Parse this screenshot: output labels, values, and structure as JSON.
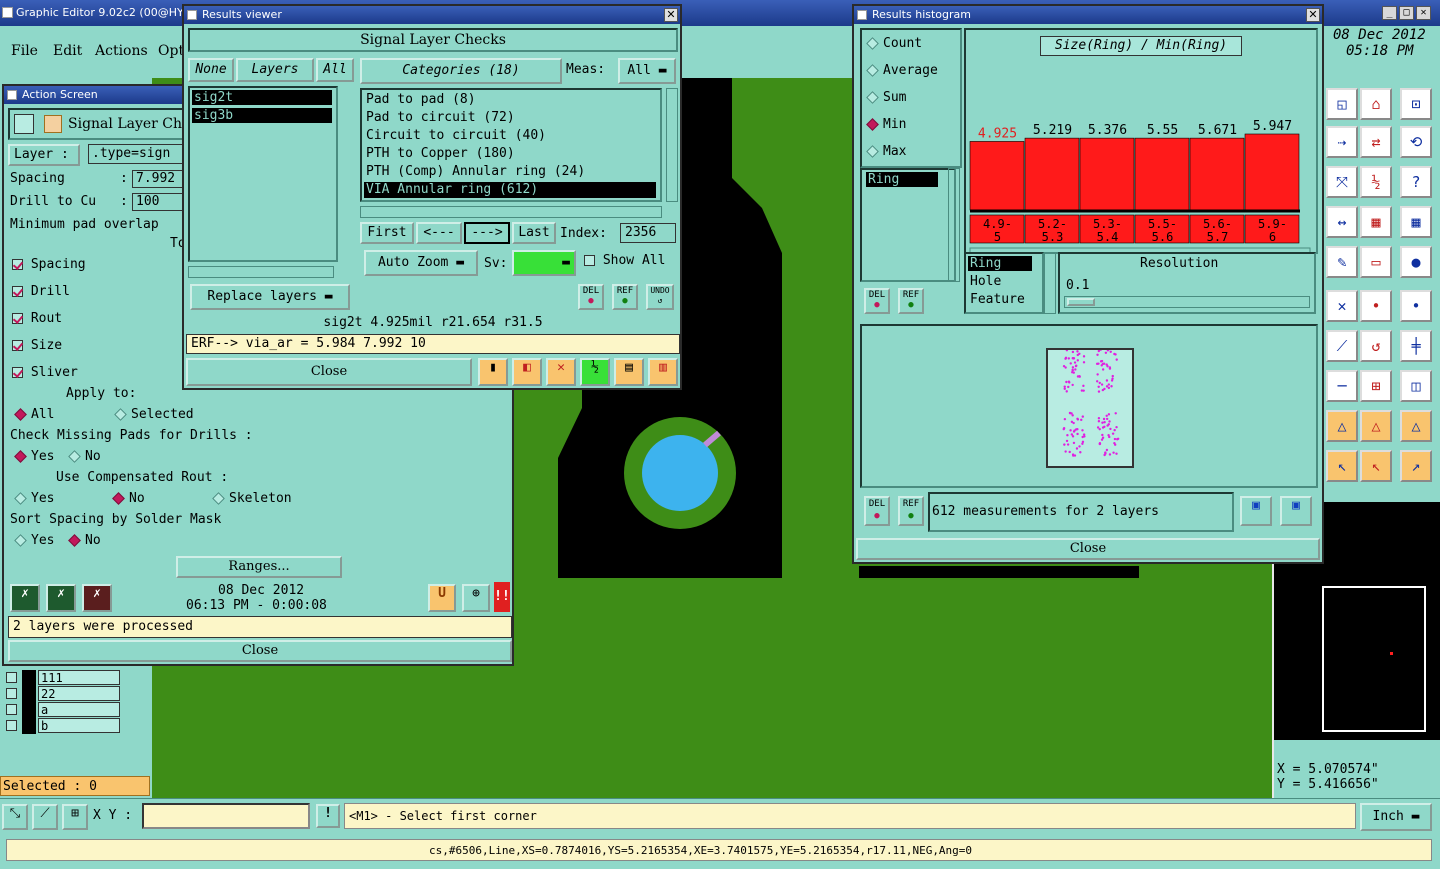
{
  "app": {
    "title": "Graphic Editor 9.02c2 (00@HY",
    "menu": [
      "File",
      "Edit",
      "Actions",
      "Opt"
    ],
    "date": "08 Dec 2012",
    "time": "05:18 PM"
  },
  "action_screen": {
    "title": "Action Screen",
    "header": "Signal Layer Chec",
    "layer_label": "Layer",
    "layer_value": ".type=sign",
    "spacing_label": "Spacing",
    "spacing_value": "7.992",
    "drill_label": "Drill to Cu",
    "drill_value": "100",
    "min_pad_label": "Minimum pad overlap",
    "to_label": "To",
    "checks": [
      "Spacing",
      "Drill",
      "Rout",
      "Size",
      "Sliver"
    ],
    "apply_label": "Apply to:",
    "apply_all": "All",
    "apply_selected": "Selected",
    "missing_pads_label": "Check Missing Pads for Drills :",
    "missing_yes": "Yes",
    "missing_no": "No",
    "comp_rout_label": "Use Compensated Rout :",
    "comp_yes": "Yes",
    "comp_no": "No",
    "comp_skeleton": "Skeleton",
    "sort_label": "Sort Spacing by Solder Mask",
    "sort_yes": "Yes",
    "sort_no": "No",
    "ranges_button": "Ranges...",
    "run_date": "08 Dec 2012",
    "run_time": "06:13 PM - 0:00:08",
    "status": "2 layers were processed",
    "close": "Close"
  },
  "results_viewer": {
    "title": "Results viewer",
    "header": "Signal Layer Checks",
    "none_btn": "None",
    "layers_btn": "Layers",
    "all_btn": "All",
    "layers": [
      "sig2t",
      "sig3b"
    ],
    "categories_btn": "Categories (18)",
    "meas_label": "Meas:",
    "meas_value": "All",
    "categories": [
      "Pad to pad (8)",
      "Pad to circuit (72)",
      "Circuit to circuit (40)",
      "PTH to Copper (180)",
      "PTH (Comp) Annular ring (24)",
      "VIA Annular ring (612)"
    ],
    "first_btn": "First",
    "prev_btn": "<---",
    "next_btn": "--->",
    "last_btn": "Last",
    "index_label": "Index:",
    "index_value": "2356",
    "replace_btn": "Replace layers",
    "autozoom_btn": "Auto Zoom",
    "sv_label": "Sv:",
    "show_all": "Show All",
    "del": "DEL",
    "ref": "REF",
    "undo": "UNDO",
    "info": "sig2t 4.925mil  r21.654  r31.5",
    "erf": "ERF--> via_ar = 5.984 7.992 10",
    "close": "Close"
  },
  "histogram": {
    "title": "Results histogram",
    "options": [
      "Count",
      "Average",
      "Sum",
      "Min",
      "Max"
    ],
    "selected_option": "Min",
    "list_item": "Ring",
    "chart_title": "Size(Ring) / Min(Ring)",
    "feature_list": [
      "Ring",
      "Hole",
      "Feature"
    ],
    "resolution_label": "Resolution",
    "resolution_value": "0.1",
    "measurements": "612 measurements for 2 layers",
    "del": "DEL",
    "ref": "REF",
    "close": "Close"
  },
  "chart_data": {
    "type": "bar",
    "title": "Size(Ring) / Min(Ring)",
    "categories": [
      "4.9-5",
      "5.2-5.3",
      "5.3-5.4",
      "5.5-5.6",
      "5.6-5.7",
      "5.9-6"
    ],
    "value_labels": [
      "4.925",
      "5.219",
      "5.376",
      "5.55",
      "5.671",
      "5.947"
    ],
    "values": [
      4.925,
      5.219,
      5.376,
      5.55,
      5.671,
      5.947
    ],
    "bar_fraction": [
      0.83,
      0.87,
      0.87,
      0.87,
      0.87,
      0.92
    ]
  },
  "layers_panel": {
    "rows": [
      "111",
      "22",
      "a",
      "b"
    ],
    "selected": "Selected : 0"
  },
  "coords": {
    "x": "X = 5.070574\"",
    "y": "Y = 5.416656\""
  },
  "bottom": {
    "xy_label": "X Y :",
    "prompt": "<M1> - Select first corner",
    "units": "Inch",
    "status_line": "cs,#6506,Line,XS=0.7874016,YS=5.2165354,XE=3.7401575,YE=5.2165354,r17.11,NEG,Ang=0"
  },
  "colors": {
    "panel": "#8fd8c9",
    "board": "#3e8d17",
    "bar": "#ff1a1a",
    "via": "#3db3ee"
  }
}
